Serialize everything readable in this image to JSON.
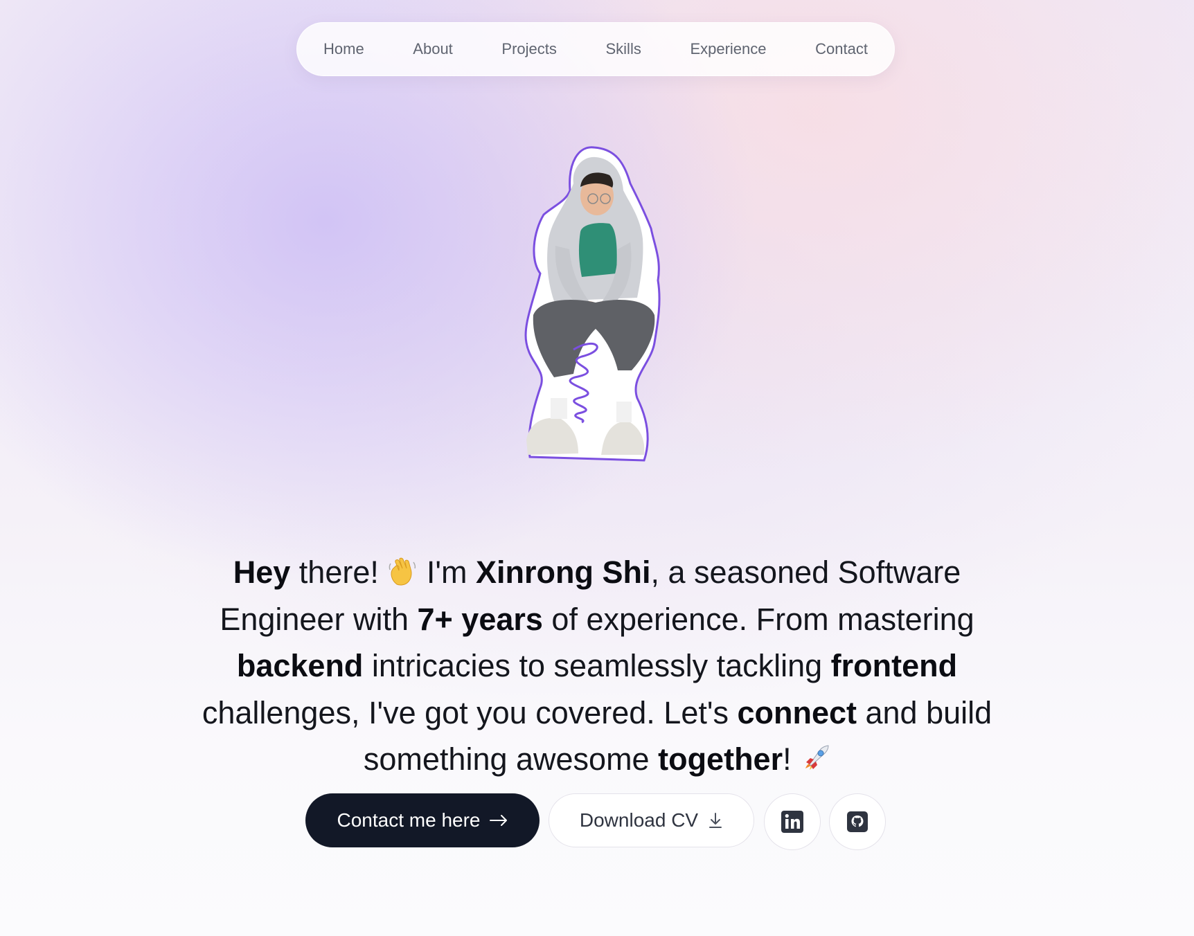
{
  "nav": {
    "items": [
      {
        "label": "Home"
      },
      {
        "label": "About"
      },
      {
        "label": "Projects"
      },
      {
        "label": "Skills"
      },
      {
        "label": "Experience"
      },
      {
        "label": "Contact"
      }
    ]
  },
  "hero": {
    "photo_icon": "portrait-cutout",
    "intro": {
      "hey": "Hey",
      "there": " there! ",
      "wave_icon": "waving-hand-emoji",
      "im": " I'm ",
      "name": "Xinrong Shi",
      "seasoned": ", a seasoned Software Engineer with ",
      "years": "7+ years",
      "of_exp": " of experience. From mastering ",
      "backend": "backend",
      "intricacies": " intricacies to seamlessly tackling ",
      "frontend": "frontend",
      "challenges": " challenges, I've got you covered. Let's ",
      "connect": "connect",
      "build": " and build something awesome ",
      "together": "together",
      "bang": "! ",
      "rocket_icon": "rocket-emoji"
    }
  },
  "actions": {
    "contact_label": "Contact me here",
    "contact_icon": "arrow-right-icon",
    "cv_label": "Download CV",
    "cv_icon": "download-icon",
    "linkedin_icon": "linkedin-icon",
    "github_icon": "github-icon"
  },
  "colors": {
    "primary_button": "#121827",
    "outline_accent": "#7b4fe0",
    "text": "#14161d"
  }
}
